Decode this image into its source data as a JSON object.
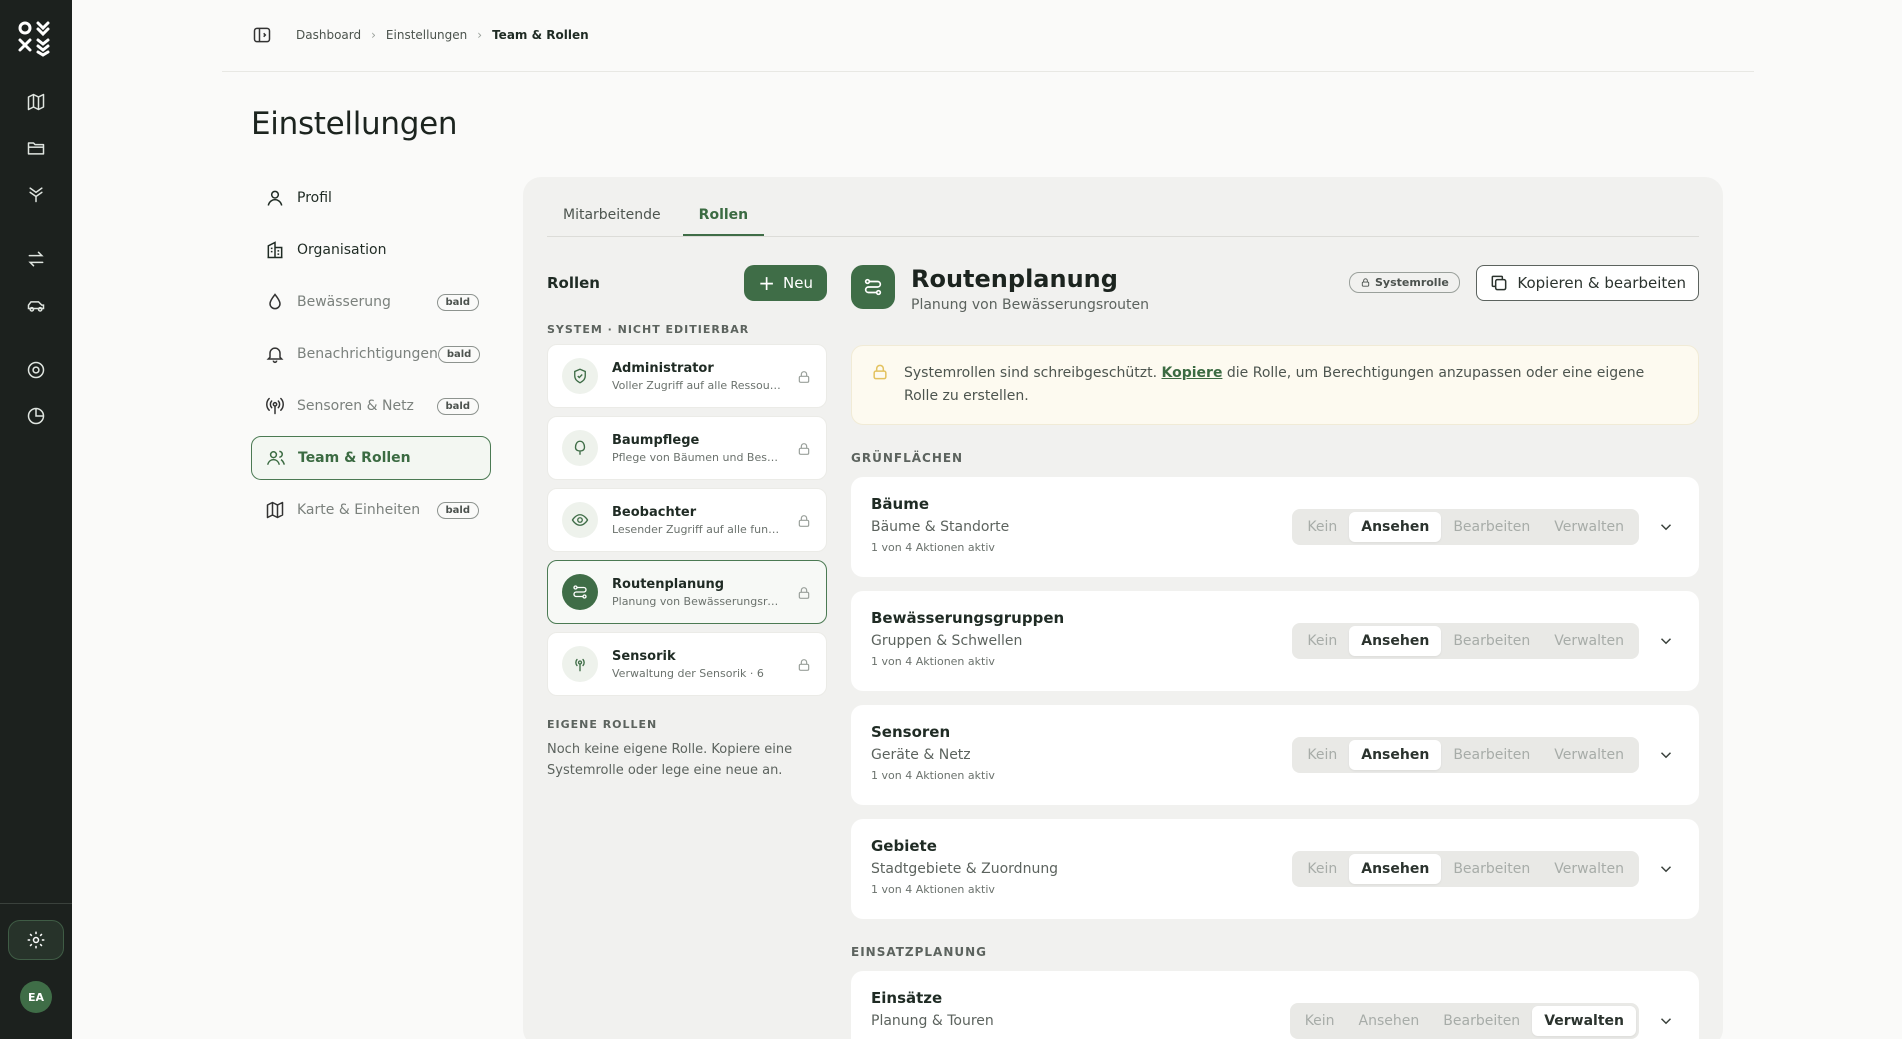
{
  "breadcrumb": [
    "Dashboard",
    "Einstellungen",
    "Team & Rollen"
  ],
  "page_title": "Einstellungen",
  "settings_nav": [
    {
      "label": "Profil",
      "icon": "user-icon",
      "badge": null,
      "state": "normal"
    },
    {
      "label": "Organisation",
      "icon": "building-icon",
      "badge": null,
      "state": "normal"
    },
    {
      "label": "Bewässerung",
      "icon": "droplet-icon",
      "badge": "bald",
      "state": "disabled"
    },
    {
      "label": "Benachrichtigungen",
      "icon": "bell-icon",
      "badge": "bald",
      "state": "disabled"
    },
    {
      "label": "Sensoren & Netz",
      "icon": "antenna-icon",
      "badge": "bald",
      "state": "disabled"
    },
    {
      "label": "Team & Rollen",
      "icon": "users-icon",
      "badge": null,
      "state": "active"
    },
    {
      "label": "Karte & Einheiten",
      "icon": "map-icon",
      "badge": "bald",
      "state": "disabled"
    }
  ],
  "tabs": [
    "Mitarbeitende",
    "Rollen"
  ],
  "active_tab": "Rollen",
  "roles_panel": {
    "title": "Rollen",
    "new_button": "Neu",
    "system_label": "SYSTEM · NICHT EDITIERBAR",
    "own_label": "EIGENE ROLLEN",
    "empty_text": "Noch keine eigene Rolle. Kopiere eine Systemrolle oder lege eine neue an.",
    "roles": [
      {
        "name": "Administrator",
        "desc": "Voller Zugriff auf alle Ressourcen",
        "icon": "shield-check-icon"
      },
      {
        "name": "Baumpflege",
        "desc": "Pflege von Bäumen und Beständen",
        "icon": "tree-icon"
      },
      {
        "name": "Beobachter",
        "desc": "Lesender Zugriff auf alle funktionen",
        "icon": "eye-icon"
      },
      {
        "name": "Routenplanung",
        "desc": "Planung von Bewässerungsrouten",
        "icon": "route-icon"
      },
      {
        "name": "Sensorik",
        "desc": "Verwaltung der Sensorik · 6",
        "icon": "antenna-icon"
      }
    ]
  },
  "detail": {
    "title": "Routenplanung",
    "subtitle": "Planung von Bewässerungsrouten",
    "system_badge": "Systemrolle",
    "copy_button": "Kopieren & bearbeiten",
    "notice_pre": "Systemrollen sind schreibgeschützt. ",
    "notice_link": "Kopiere",
    "notice_post": " die Rolle, um Berechtigungen anzupassen oder eine eigene Rolle zu erstellen.",
    "segments": [
      "Kein",
      "Ansehen",
      "Bearbeiten",
      "Verwalten"
    ],
    "groups": [
      {
        "label": "GRÜNFLÄCHEN",
        "items": [
          {
            "name": "Bäume",
            "desc": "Bäume & Standorte",
            "count": "1 von 4 Aktionen aktiv",
            "level": "Ansehen"
          },
          {
            "name": "Bewässerungsgruppen",
            "desc": "Gruppen & Schwellen",
            "count": "1 von 4 Aktionen aktiv",
            "level": "Ansehen"
          },
          {
            "name": "Sensoren",
            "desc": "Geräte & Netz",
            "count": "1 von 4 Aktionen aktiv",
            "level": "Ansehen"
          },
          {
            "name": "Gebiete",
            "desc": "Stadtgebiete & Zuordnung",
            "count": "1 von 4 Aktionen aktiv",
            "level": "Ansehen"
          }
        ]
      },
      {
        "label": "EINSATZPLANUNG",
        "items": [
          {
            "name": "Einsätze",
            "desc": "Planung & Touren",
            "count": "",
            "level": "Verwalten"
          }
        ]
      }
    ]
  },
  "user": {
    "initials": "EA"
  },
  "colors": {
    "brand": "#3f6d47",
    "rail": "#1c211e",
    "notice_bg": "#fdfaf0"
  }
}
